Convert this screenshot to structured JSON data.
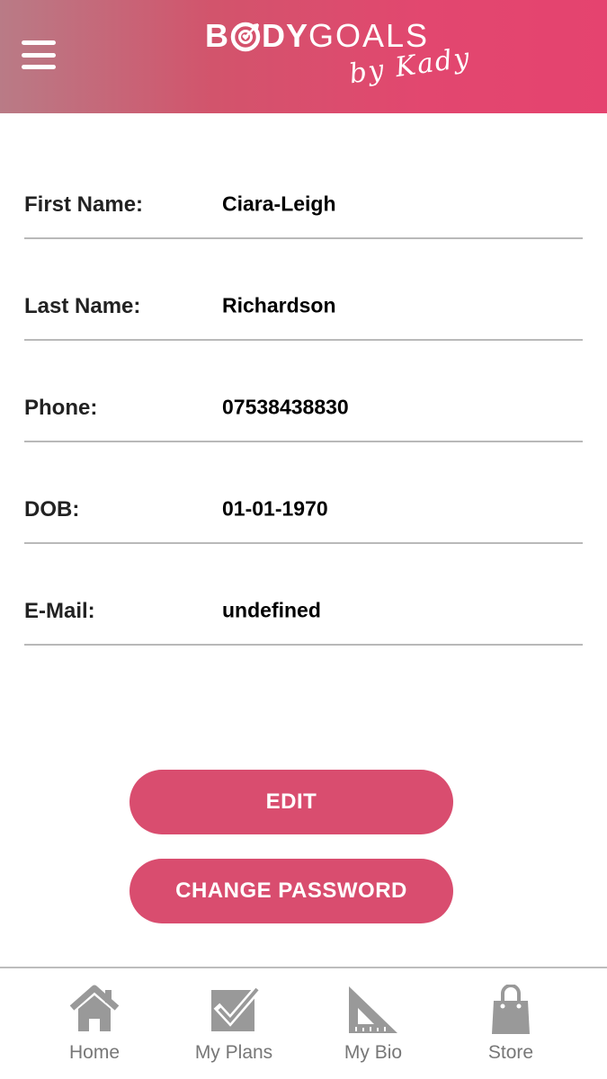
{
  "header": {
    "menu_icon": "hamburger-menu-icon",
    "logo": {
      "word_left": "B",
      "word_mid": "DY",
      "word_right": "GOALS",
      "script": "by Kady"
    }
  },
  "profile": {
    "fields": [
      {
        "label": "First Name:",
        "value": "Ciara-Leigh"
      },
      {
        "label": "Last Name:",
        "value": "Richardson"
      },
      {
        "label": "Phone:",
        "value": "07538438830"
      },
      {
        "label": "DOB:",
        "value": "01-01-1970"
      },
      {
        "label": "E-Mail:",
        "value": "undefined"
      }
    ]
  },
  "actions": {
    "edit_label": "EDIT",
    "change_password_label": "CHANGE PASSWORD",
    "button_color": "#d94d6f"
  },
  "tabbar": {
    "tabs": [
      {
        "label": "Home",
        "icon": "home-icon"
      },
      {
        "label": "My Plans",
        "icon": "checkbox-icon"
      },
      {
        "label": "My Bio",
        "icon": "set-square-icon"
      },
      {
        "label": "Store",
        "icon": "shopping-bag-icon"
      }
    ]
  },
  "colors": {
    "header_start": "#b97b86",
    "header_end": "#e5436f",
    "accent": "#d94d6f",
    "icon_gray": "#999999"
  }
}
